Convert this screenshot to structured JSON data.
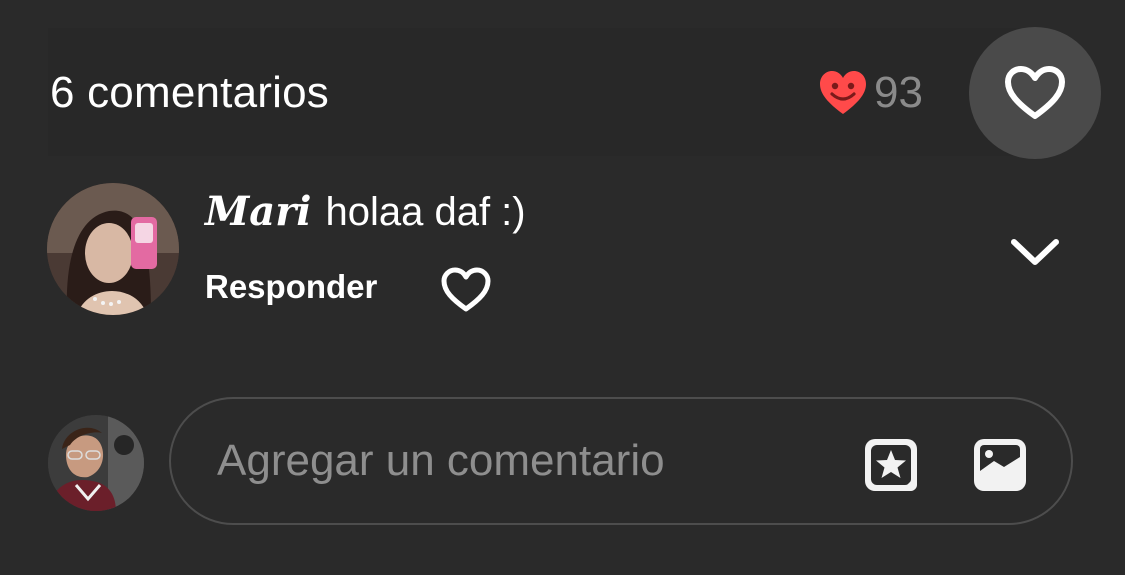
{
  "header": {
    "comment_count_label": "6 comentarios",
    "likes_count": "93",
    "icons": {
      "likes": "heart-face-icon",
      "like_button": "heart-outline-icon"
    }
  },
  "comments": [
    {
      "author": "Mari",
      "text": "holaa daf :)",
      "reply_label": "Responder",
      "icons": {
        "avatar": "avatar",
        "like": "heart-outline-icon",
        "expand": "chevron-down-icon"
      }
    }
  ],
  "composer": {
    "placeholder": "Agregar un comentario",
    "value": "",
    "icons": {
      "sticker": "sticker-star-icon",
      "image": "image-icon"
    }
  },
  "colors": {
    "background": "#2a2a2a",
    "like_heart": "#ff4a4a",
    "muted_text": "#8a8a8a",
    "circle_button": "#4a4a4a",
    "input_border": "#4d4d4d"
  }
}
